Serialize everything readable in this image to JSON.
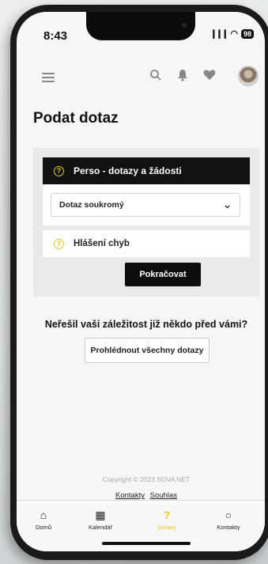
{
  "status_bar": {
    "time": "8:43",
    "signal": "❙❙❙",
    "wifi": "◠",
    "battery": "98"
  },
  "header": {},
  "page": {
    "title": "Podat dotaz"
  },
  "form": {
    "category_header": "Perso - dotazy a žádosti",
    "select_value": "Dotaz soukromý",
    "second_category": "Hlášení chyb",
    "continue_label": "Pokračovat",
    "question_icon": "?"
  },
  "prompt": {
    "question": "Neřešil vaši záležitost již někdo před vámi?",
    "browse_label": "Prohlédnout všechny dotazy"
  },
  "footer": {
    "copyright": "Copyright © 2023 SOVA NET",
    "links": [
      "Kontakty",
      "Souhlas"
    ]
  },
  "tabbar": {
    "tabs": [
      {
        "label": "Domů",
        "icon": "home-icon",
        "glyph": "⌂",
        "active": false
      },
      {
        "label": "Kalendář",
        "icon": "calendar-icon",
        "glyph": "▦",
        "active": false
      },
      {
        "label": "Dotazy",
        "icon": "question-icon",
        "glyph": "?",
        "active": true
      },
      {
        "label": "Kontakty",
        "icon": "person-icon",
        "glyph": "○",
        "active": false
      }
    ]
  },
  "colors": {
    "accent": "#efc21a",
    "dark": "#111111"
  }
}
